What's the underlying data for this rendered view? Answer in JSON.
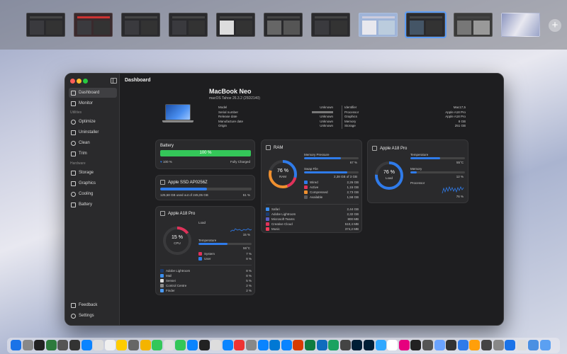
{
  "window": {
    "page_title": "Dashboard"
  },
  "sidebar": {
    "items": [
      {
        "label": "Dashboard",
        "icon": "display-icon",
        "active": true
      },
      {
        "label": "Monitor",
        "icon": "chart-icon"
      }
    ],
    "utilities_header": "Utilities",
    "utilities": [
      {
        "label": "Optimize",
        "icon": "rocket-icon"
      },
      {
        "label": "Uninstaller",
        "icon": "trash-icon"
      },
      {
        "label": "Clean",
        "icon": "broom-icon"
      },
      {
        "label": "Trim",
        "icon": "trim-icon"
      }
    ],
    "hardware_header": "Hardware",
    "hardware": [
      {
        "label": "Storage",
        "icon": "drive-icon"
      },
      {
        "label": "Graphics",
        "icon": "gpu-icon"
      },
      {
        "label": "Cooling",
        "icon": "fan-icon"
      },
      {
        "label": "Battery",
        "icon": "battery-icon"
      }
    ],
    "footer": [
      {
        "label": "Feedback",
        "icon": "feedback-icon"
      },
      {
        "label": "Settings",
        "icon": "gear-icon"
      }
    ]
  },
  "device": {
    "name": "MacBook Neo",
    "os": "macOS Tahoe 26.3.2 (25D2140)",
    "left_labels": [
      "Model",
      "Serial number",
      "Release date",
      "Manufacture date",
      "Origin"
    ],
    "left_values": [
      "Unknown",
      "",
      "Unknown",
      "Unknown",
      "Unknown"
    ],
    "right_labels": [
      "Identifier",
      "Processor",
      "Graphics",
      "Memory",
      "Storage"
    ],
    "right_values": [
      "Mac17,5",
      "Apple A18 Pro",
      "Apple A18 Pro",
      "8 GB",
      "251 GB"
    ]
  },
  "battery": {
    "title": "Battery",
    "percent_label": "100 %",
    "level": 100,
    "status_left": "100 %",
    "status_right": "Fully Charged"
  },
  "ssd": {
    "title": "Apple SSD AP0256Z",
    "used_text": "125,68 GB used out of 245,05 GB",
    "percent_label": "51 %",
    "level": 51
  },
  "cpu": {
    "title": "Apple A18 Pro",
    "ring_value": "15 %",
    "ring_label": "CPU",
    "load_label": "Load",
    "load_value": "15 %",
    "temp_label": "Temperature",
    "temp_value": "55°C",
    "temp_level": 55,
    "system_label": "System",
    "system_value": "7 %",
    "user_label": "User",
    "user_value": "8 %",
    "processes": [
      {
        "name": "Adobe Lightroom",
        "value": "8 %",
        "color": "#1c3c6e"
      },
      {
        "name": "Mail",
        "value": "8 %",
        "color": "#3a8ef0"
      },
      {
        "name": "Sensei",
        "value": "5 %",
        "color": "#dcdcdc"
      },
      {
        "name": "Control Centre",
        "value": "2 %",
        "color": "#8a8a8a"
      },
      {
        "name": "Finder",
        "value": "2 %",
        "color": "#4a9af5"
      }
    ]
  },
  "ram": {
    "title": "RAM",
    "ring_value": "76 %",
    "ring_label": "RAM",
    "pressure_label": "Memory Pressure",
    "pressure_value": "67 %",
    "pressure_level": 67,
    "swap_label": "Swap File",
    "swap_value": "2,38 GB of 3 GB",
    "swap_level": 79,
    "legend": [
      {
        "name": "Wired",
        "value": "2,26 GB",
        "color": "#2f7bea"
      },
      {
        "name": "Active",
        "value": "1,15 GB",
        "color": "#e0325a"
      },
      {
        "name": "Compressed",
        "value": "2,73 GB",
        "color": "#f0902f"
      },
      {
        "name": "Available",
        "value": "1,58 GB",
        "color": "#5a5a5e"
      }
    ],
    "apps": [
      {
        "name": "Safari",
        "value": "2,44 GB",
        "color": "#3a8ef0"
      },
      {
        "name": "Adobe Lightroom",
        "value": "2,32 GB",
        "color": "#1c3c6e"
      },
      {
        "name": "Microsoft Teams",
        "value": "800 MB",
        "color": "#5b5fc7"
      },
      {
        "name": "Creative Cloud",
        "value": "510,4 MB",
        "color": "#e0325a"
      },
      {
        "name": "Music",
        "value": "374,2 MB",
        "color": "#fa3c5a"
      }
    ]
  },
  "gpu": {
    "title": "Apple A18 Pro",
    "ring_value": "76 %",
    "ring_label": "Load",
    "temp_label": "Temperature",
    "temp_value": "55°C",
    "temp_level": 55,
    "memory_label": "Memory",
    "memory_value": "12 %",
    "memory_level": 12,
    "processor_label": "Processor",
    "processor_value": "76 %"
  },
  "colors": {
    "accent": "#2f7bea",
    "battery_green": "#34c759",
    "danger": "#e0325a"
  }
}
